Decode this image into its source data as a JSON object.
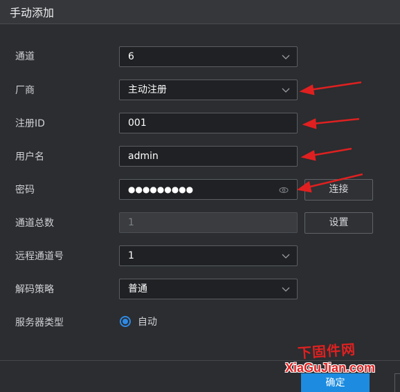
{
  "dialog": {
    "title": "手动添加"
  },
  "form": {
    "channel": {
      "label": "通道",
      "value": "6"
    },
    "manufacturer": {
      "label": "厂商",
      "value": "主动注册"
    },
    "register_id": {
      "label": "注册ID",
      "value": "001"
    },
    "username": {
      "label": "用户名",
      "value": "admin"
    },
    "password": {
      "label": "密码",
      "value": "●●●●●●●●●"
    },
    "total_channels": {
      "label": "通道总数",
      "value": "1"
    },
    "remote_channel": {
      "label": "远程通道号",
      "value": "1"
    },
    "decode_strategy": {
      "label": "解码策略",
      "value": "普通"
    },
    "server_type": {
      "label": "服务器类型",
      "option": "自动"
    }
  },
  "buttons": {
    "connect": "连接",
    "settings": "设置",
    "confirm": "确定"
  },
  "watermark": {
    "line1": "下固件网",
    "line2": "XiaGuJian.com"
  },
  "colors": {
    "accent": "#1d8ce0",
    "annotation_arrow": "#e02020",
    "background": "#2b2d30"
  },
  "icons": {
    "select": "chevron-down-icon",
    "password_toggle": "eye-icon",
    "radio": "radio-checked-icon"
  }
}
